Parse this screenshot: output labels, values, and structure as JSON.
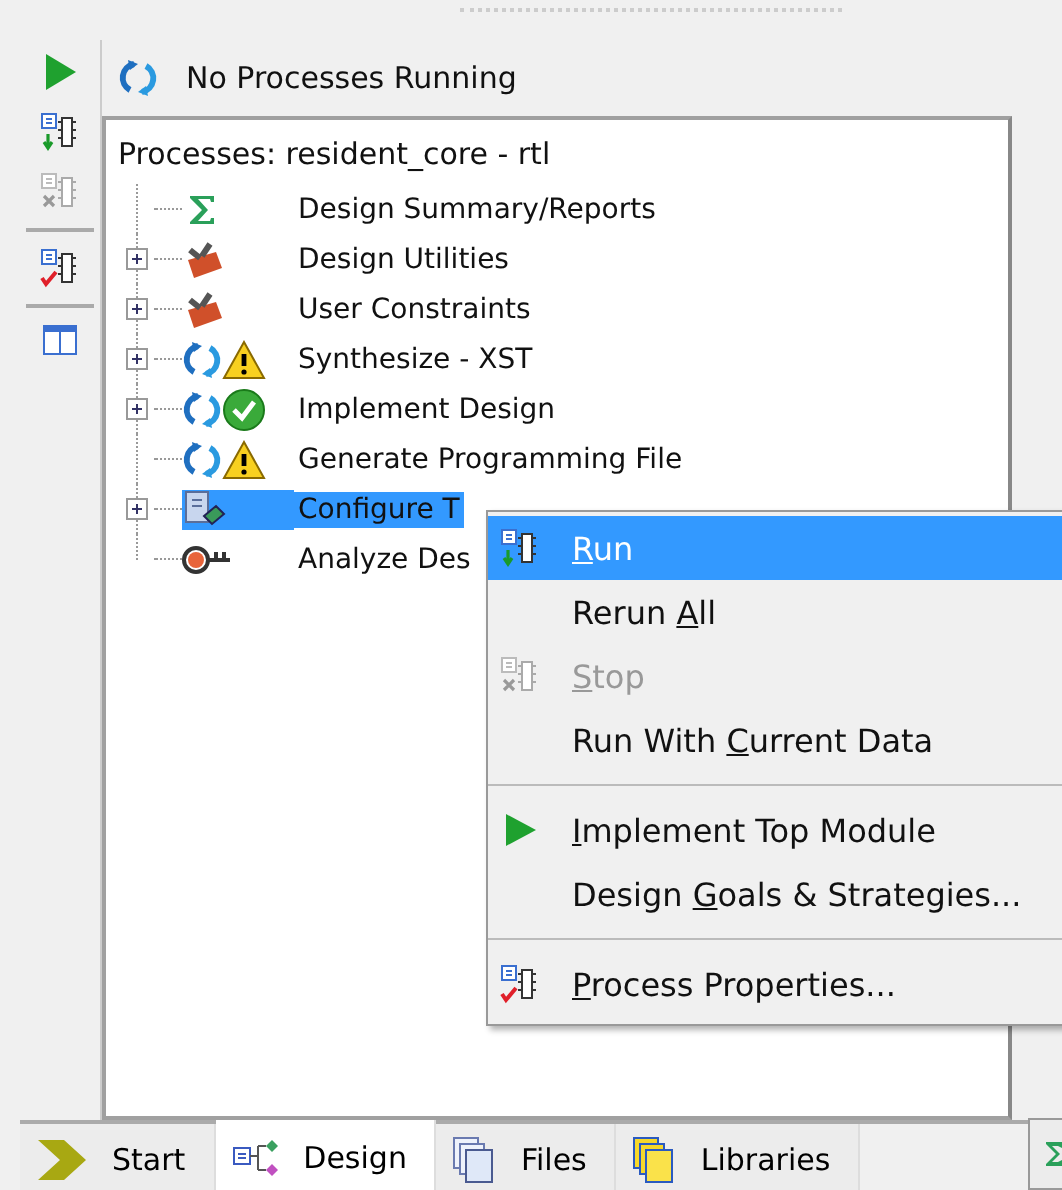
{
  "toolbar": [
    {
      "kind": "run"
    },
    {
      "kind": "rerun"
    },
    {
      "kind": "stop",
      "disabled": true
    },
    {
      "kind": "properties"
    },
    {
      "kind": "view"
    }
  ],
  "status": {
    "text": "No Processes Running"
  },
  "processes": {
    "title": "Processes: resident_core - rtl",
    "children": [
      {
        "label": "Design Summary/Reports",
        "kind": "summary",
        "expandable": false,
        "selected": false
      },
      {
        "label": "Design Utilities",
        "kind": "toolbox",
        "expandable": true,
        "selected": false
      },
      {
        "label": "User Constraints",
        "kind": "toolbox",
        "expandable": true,
        "selected": false
      },
      {
        "label": "Synthesize - XST",
        "kind": "warning",
        "expandable": true,
        "selected": false
      },
      {
        "label": "Implement Design",
        "kind": "done",
        "expandable": true,
        "selected": false
      },
      {
        "label": "Generate Programming File",
        "kind": "warning",
        "expandable": false,
        "selected": false
      },
      {
        "label": "Configure T",
        "kind": "device",
        "expandable": true,
        "selected": true
      },
      {
        "label": "Analyze Des",
        "kind": "analysis",
        "expandable": false,
        "selected": false
      }
    ]
  },
  "context_menu": [
    {
      "kind": "run",
      "key": "R",
      "post": "un",
      "selected": true,
      "disabled": false
    },
    {
      "kind": "plain",
      "pre": "Rerun ",
      "key": "A",
      "post": "ll",
      "selected": false,
      "disabled": false
    },
    {
      "kind": "stop",
      "key": "S",
      "post": "top",
      "selected": false,
      "disabled": true
    },
    {
      "kind": "plain",
      "pre": "Run With ",
      "key": "C",
      "post": "urrent Data",
      "selected": false,
      "disabled": false
    },
    {
      "kind": "separator"
    },
    {
      "kind": "play",
      "key": "I",
      "post": "mplement Top Module",
      "selected": false,
      "disabled": false
    },
    {
      "kind": "plain",
      "pre": "Design ",
      "key": "G",
      "post": "oals & Strategies...",
      "selected": false,
      "disabled": false
    },
    {
      "kind": "separator"
    },
    {
      "kind": "properties",
      "key": "P",
      "post": "rocess Properties...",
      "selected": false,
      "disabled": false
    }
  ],
  "tabs": [
    {
      "label": "Start",
      "kind": "start",
      "selected": false
    },
    {
      "label": "Design",
      "kind": "design",
      "selected": true
    },
    {
      "label": "Files",
      "kind": "files",
      "selected": false
    },
    {
      "label": "Libraries",
      "kind": "libraries",
      "selected": false
    }
  ]
}
